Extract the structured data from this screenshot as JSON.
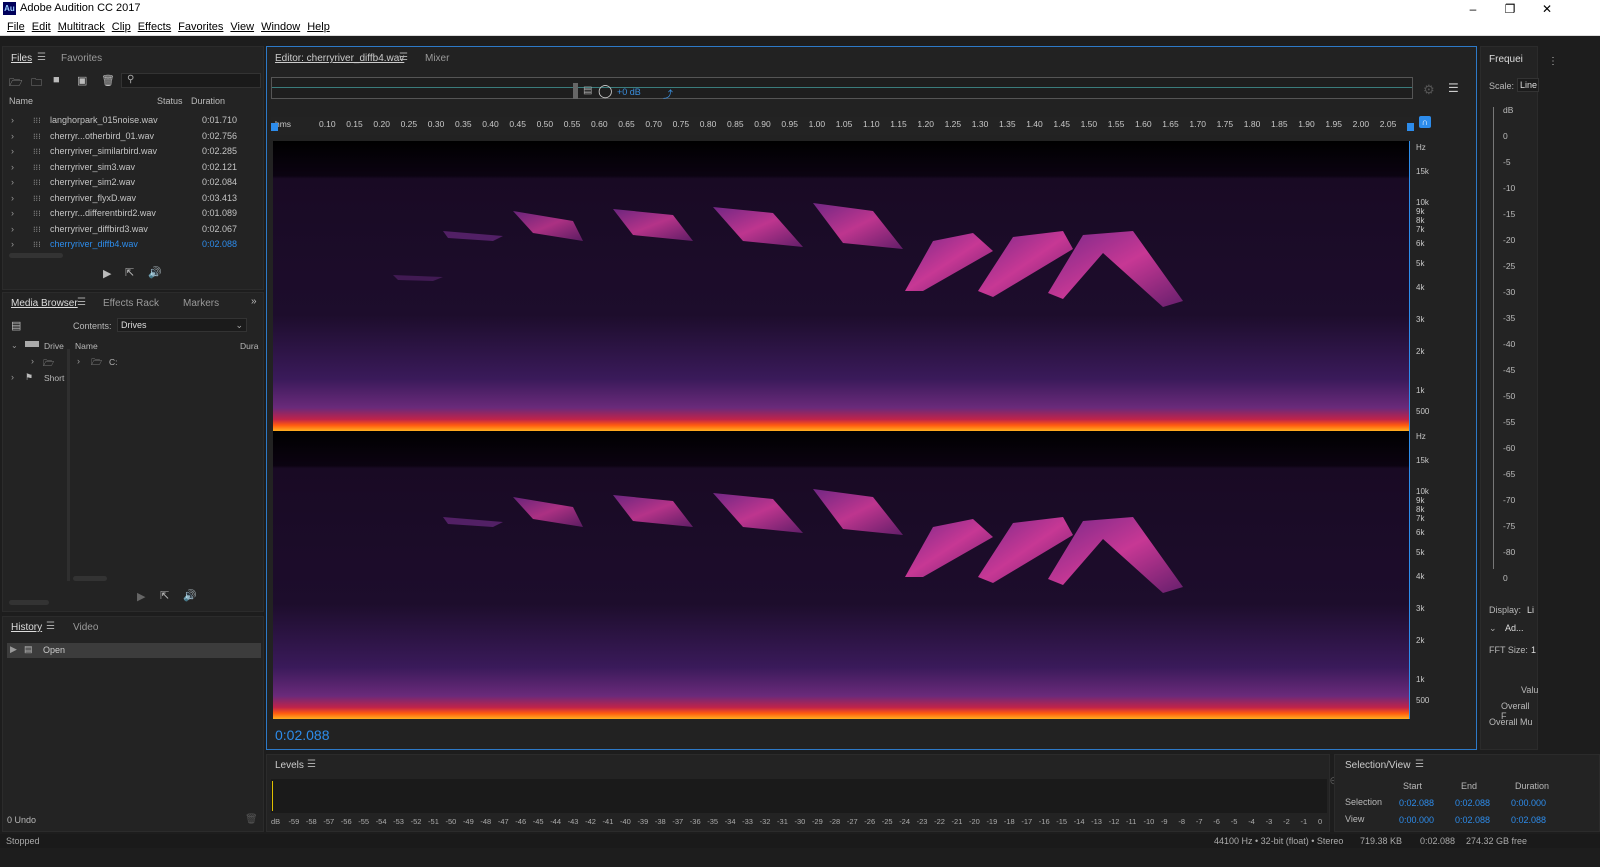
{
  "app": {
    "title": "Adobe Audition CC 2017",
    "logo": "Au"
  },
  "menu": [
    "File",
    "Edit",
    "Multitrack",
    "Clip",
    "Effects",
    "Favorites",
    "View",
    "Window",
    "Help"
  ],
  "files_panel": {
    "tabs": [
      "Files",
      "Favorites"
    ],
    "columns": {
      "name": "Name",
      "status": "Status",
      "duration": "Duration"
    },
    "items": [
      {
        "name": "langhorpark_015noise.wav",
        "duration": "0:01.710"
      },
      {
        "name": "cherryr...otherbird_01.wav",
        "duration": "0:02.756"
      },
      {
        "name": "cherryriver_similarbird.wav",
        "duration": "0:02.285"
      },
      {
        "name": "cherryriver_sim3.wav",
        "duration": "0:02.121"
      },
      {
        "name": "cherryriver_sim2.wav",
        "duration": "0:02.084"
      },
      {
        "name": "cherryriver_flyxD.wav",
        "duration": "0:03.413"
      },
      {
        "name": "cherryr...differentbird2.wav",
        "duration": "0:01.089"
      },
      {
        "name": "cherryriver_diffbird3.wav",
        "duration": "0:02.067"
      },
      {
        "name": "cherryriver_diffb4.wav",
        "duration": "0:02.088",
        "selected": true
      }
    ]
  },
  "media_browser": {
    "tabs": [
      "Media Browser",
      "Effects Rack",
      "Markers"
    ],
    "contents_label": "Contents:",
    "contents_value": "Drives",
    "tree": [
      "Drive",
      "Short"
    ],
    "col_name": "Name",
    "col_dur": "Dura",
    "drive_item": "C:"
  },
  "history": {
    "tabs": [
      "History",
      "Video"
    ],
    "items": [
      "Open"
    ],
    "undo": "0 Undo"
  },
  "status": {
    "left": "Stopped",
    "right": [
      "44100 Hz • 32-bit (float) • Stereo",
      "719.38 KB",
      "0:02.088",
      "274.32 GB free"
    ]
  },
  "editor": {
    "tabs": [
      "Editor: cherryriver_diffb4.wav",
      "Mixer"
    ],
    "gain": "+0 dB",
    "time_display": "0:02.088",
    "ruler_unit": "hms",
    "ticks": [
      "0.10",
      "0.15",
      "0.20",
      "0.25",
      "0.30",
      "0.35",
      "0.40",
      "0.45",
      "0.50",
      "0.55",
      "0.60",
      "0.65",
      "0.70",
      "0.75",
      "0.80",
      "0.85",
      "0.90",
      "0.95",
      "1.00",
      "1.05",
      "1.10",
      "1.15",
      "1.20",
      "1.25",
      "1.30",
      "1.35",
      "1.40",
      "1.45",
      "1.50",
      "1.55",
      "1.60",
      "1.65",
      "1.70",
      "1.75",
      "1.80",
      "1.85",
      "1.90",
      "1.95",
      "2.00",
      "2.05"
    ],
    "hz_labels": [
      "Hz",
      "15k",
      "10k",
      "9k",
      "8k",
      "7k",
      "6k",
      "5k",
      "4k",
      "3k",
      "2k",
      "1k",
      "500"
    ]
  },
  "levels": {
    "title": "Levels",
    "scale": [
      "dB",
      "-59",
      "-58",
      "-57",
      "-56",
      "-55",
      "-54",
      "-53",
      "-52",
      "-51",
      "-50",
      "-49",
      "-48",
      "-47",
      "-46",
      "-45",
      "-44",
      "-43",
      "-42",
      "-41",
      "-40",
      "-39",
      "-38",
      "-37",
      "-36",
      "-35",
      "-34",
      "-33",
      "-32",
      "-31",
      "-30",
      "-29",
      "-28",
      "-27",
      "-26",
      "-25",
      "-24",
      "-23",
      "-22",
      "-21",
      "-20",
      "-19",
      "-18",
      "-17",
      "-16",
      "-15",
      "-14",
      "-13",
      "-12",
      "-11",
      "-10",
      "-9",
      "-8",
      "-7",
      "-6",
      "-5",
      "-4",
      "-3",
      "-2",
      "-1",
      "0"
    ]
  },
  "selection_view": {
    "title": "Selection/View",
    "headers": [
      "Start",
      "End",
      "Duration"
    ],
    "selection": {
      "label": "Selection",
      "start": "0:02.088",
      "end": "0:02.088",
      "duration": "0:00.000"
    },
    "view": {
      "label": "View",
      "start": "0:00.000",
      "end": "0:02.088",
      "duration": "0:02.088"
    }
  },
  "freq_panel": {
    "title": "Frequei",
    "scale_label": "Scale:",
    "scale_value": "Line",
    "db_scale": [
      "dB",
      "0",
      "-5",
      "-10",
      "-15",
      "-20",
      "-25",
      "-30",
      "-35",
      "-40",
      "-45",
      "-50",
      "-55",
      "-60",
      "-65",
      "-70",
      "-75",
      "-80",
      "0"
    ],
    "display_label": "Display:",
    "display_value": "Li",
    "advanced": "Ad...",
    "fft_label": "FFT Size:",
    "fft_value": "1",
    "footer": [
      "Valu",
      "Overall F",
      "Overall Mu"
    ]
  }
}
